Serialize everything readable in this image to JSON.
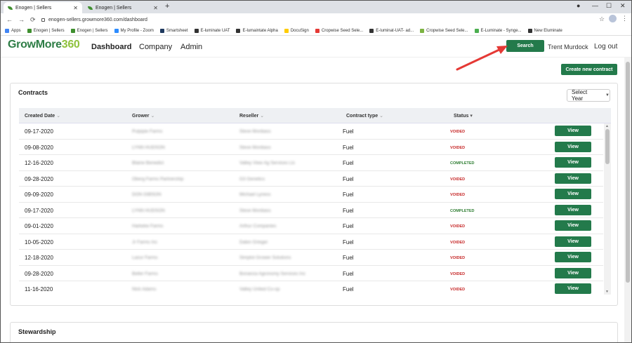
{
  "browser": {
    "tabs": [
      {
        "title": "Enogen | Sellers",
        "active": true
      },
      {
        "title": "Enogen | Sellers",
        "active": false
      }
    ],
    "url": "enogen-sellers.growmore360.com/dashboard",
    "bookmarks": [
      {
        "label": "Apps",
        "color": "#4285f4"
      },
      {
        "label": "Enogen | Sellers",
        "color": "#3f8f2f"
      },
      {
        "label": "Enogen | Sellers",
        "color": "#3f8f2f"
      },
      {
        "label": "My Profile - Zoom",
        "color": "#2d8cff"
      },
      {
        "label": "Smartsheet",
        "color": "#1f3a5f"
      },
      {
        "label": "E-luminate UAT",
        "color": "#333333"
      },
      {
        "label": "E-lumaintate Alpha",
        "color": "#333333"
      },
      {
        "label": "DocuSign",
        "color": "#ffcc00"
      },
      {
        "label": "Cropwise Seed Sele...",
        "color": "#e53935"
      },
      {
        "label": "E-luminat-UAT- ad...",
        "color": "#333333"
      },
      {
        "label": "Cropwise Seed Sele...",
        "color": "#7cb342"
      },
      {
        "label": "E-Luminate - Synge...",
        "color": "#4caf50"
      },
      {
        "label": "New Eluminate",
        "color": "#333333"
      }
    ]
  },
  "app": {
    "logo_text": "GrowMore",
    "logo_number": "360",
    "nav": [
      "Dashboard",
      "Company",
      "Admin"
    ],
    "search_label": "Search",
    "user_name": "Trent Murdock",
    "logout_label": "Log out",
    "create_label": "Create new contract",
    "accent_color": "#237a4b"
  },
  "contracts": {
    "title": "Contracts",
    "select_year": "Select Year",
    "columns": [
      "Created Date",
      "Grower",
      "Reseller",
      "Contract type",
      "Status"
    ],
    "view_label": "View",
    "rows": [
      {
        "date": "09-17-2020",
        "grower": "Pulpipie Farms",
        "reseller": "Steve Monbass",
        "type": "Fuel",
        "status": "VOIDED"
      },
      {
        "date": "09-08-2020",
        "grower": "LYNN HUDSON",
        "reseller": "Steve Monbass",
        "type": "Fuel",
        "status": "VOIDED"
      },
      {
        "date": "12-16-2020",
        "grower": "Blaine Benedict",
        "reseller": "Valley View Ag Services Llc",
        "type": "Fuel",
        "status": "COMPLETED"
      },
      {
        "date": "09-28-2020",
        "grower": "Oberg Farms Partnership",
        "reseller": "G3 Genetics",
        "type": "Fuel",
        "status": "VOIDED"
      },
      {
        "date": "09-09-2020",
        "grower": "DON GIBSON",
        "reseller": "Michael Lyness",
        "type": "Fuel",
        "status": "VOIDED"
      },
      {
        "date": "09-17-2020",
        "grower": "LYNN HUDSON",
        "reseller": "Steve Monbass",
        "type": "Fuel",
        "status": "COMPLETED"
      },
      {
        "date": "09-01-2020",
        "grower": "Harkeke Farms",
        "reseller": "Arthur Companies",
        "type": "Fuel",
        "status": "VOIDED"
      },
      {
        "date": "10-05-2020",
        "grower": "Jr Farms Inc",
        "reseller": "Dalen Grieger",
        "type": "Fuel",
        "status": "VOIDED"
      },
      {
        "date": "12-18-2020",
        "grower": "Lazur Farms",
        "reseller": "Simplot Grower Solutions",
        "type": "Fuel",
        "status": "VOIDED"
      },
      {
        "date": "09-28-2020",
        "grower": "Beller Farms",
        "reseller": "Bonanza Agronomy Services Inc",
        "type": "Fuel",
        "status": "VOIDED"
      },
      {
        "date": "11-16-2020",
        "grower": "Nick Adams",
        "reseller": "Valley United Co-op",
        "type": "Fuel",
        "status": "VOIDED"
      }
    ]
  },
  "stewardship": {
    "title": "Stewardship"
  }
}
